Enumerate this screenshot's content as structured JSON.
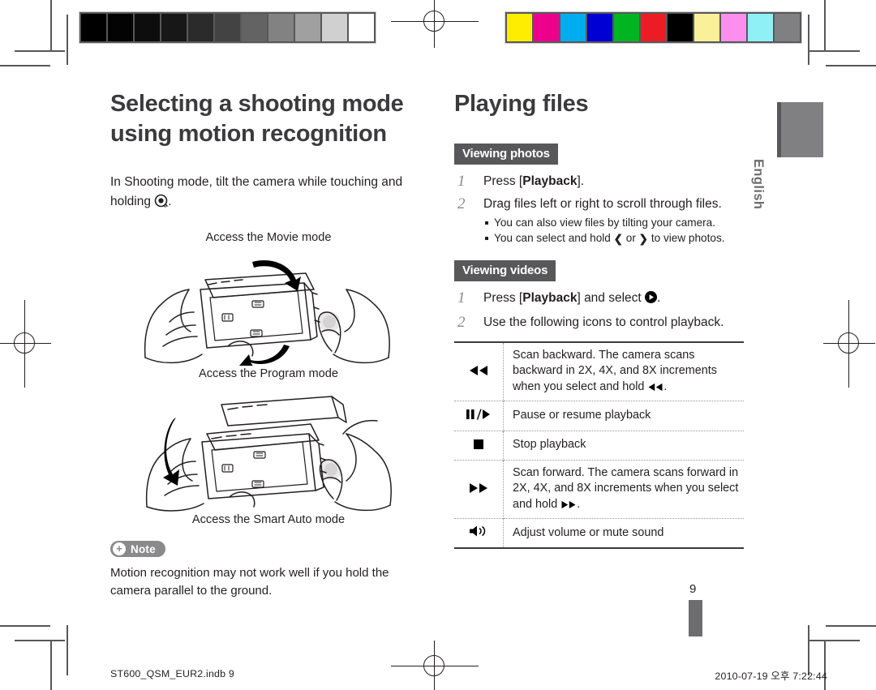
{
  "document": {
    "language_tab": "English",
    "page_number": "9",
    "footer_file": "ST600_QSM_EUR2.indb   9",
    "footer_timestamp": "2010-07-19   오후 7:22:44"
  },
  "left_column": {
    "title_line1": "Selecting a shooting mode",
    "title_line2": "using motion recognition",
    "intro_part1": "In Shooting mode, tilt the camera while touching and holding ",
    "intro_icon": "motion-recognition-icon",
    "intro_part2": ".",
    "illustration_1": {
      "caption_top": "Access the Movie mode",
      "caption_bottom": "Access the Program mode",
      "alt": "Two hands holding a camera horizontally with curved arrows showing tilt up and tilt down"
    },
    "illustration_2": {
      "caption_bottom": "Access the Smart Auto mode",
      "alt": "Two hands tilting a camera downward with a curved arrow"
    },
    "note": {
      "badge_label": "Note",
      "badge_icon": "plus-circle-icon",
      "text": "Motion recognition may not work well if you hold the camera parallel to the ground."
    }
  },
  "right_column": {
    "title": "Playing files",
    "sections": [
      {
        "heading": "Viewing photos",
        "steps": [
          {
            "num": "1",
            "text_before": "Press [",
            "bold": "Playback",
            "text_after": "]."
          },
          {
            "num": "2",
            "text_before": "Drag files left or right to scroll through files.",
            "bold": "",
            "text_after": "",
            "subnotes": [
              "You can also view files by tilting your camera.",
              "You can select and hold ‹ or › to view photos."
            ]
          }
        ]
      },
      {
        "heading": "Viewing videos",
        "steps": [
          {
            "num": "1",
            "text_before": "Press [",
            "bold": "Playback",
            "text_after": "] and select ▶."
          },
          {
            "num": "2",
            "text_before": "Use the following icons to control playback.",
            "bold": "",
            "text_after": ""
          }
        ]
      }
    ],
    "control_table": {
      "rows": [
        {
          "icon": "rewind-icon",
          "icon_glyph": "◀◀",
          "description": "Scan backward. The camera scans backward in 2X, 4X, and 8X increments when you select and hold ◀◀."
        },
        {
          "icon": "pause-play-icon",
          "icon_glyph": "❙❙/▶",
          "description": "Pause or resume playback"
        },
        {
          "icon": "stop-icon",
          "icon_glyph": "■",
          "description": "Stop playback"
        },
        {
          "icon": "fast-forward-icon",
          "icon_glyph": "▶▶",
          "description": "Scan forward. The camera scans forward in 2X, 4X, and 8X increments when you select and hold ▶▶."
        },
        {
          "icon": "volume-icon",
          "icon_glyph": "🔊",
          "description": "Adjust volume or mute sound"
        }
      ]
    }
  },
  "print_marks": {
    "grayscale_strip": [
      "#000000",
      "#030303",
      "#0d0d0d",
      "#171717",
      "#2b2b2b",
      "#434343",
      "#636363",
      "#828282",
      "#a0a0a0",
      "#d0d0d0",
      "#ffffff"
    ],
    "color_strip": [
      "#ffed00",
      "#ec008c",
      "#00aeef",
      "#0000d4",
      "#00b521",
      "#ed1c24",
      "#000000",
      "#fbf09a",
      "#fb8fee",
      "#8ff0f5",
      "#808083"
    ],
    "registration_icon": "registration-crosshair-icon",
    "crop_icon": "crop-mark-icon"
  }
}
